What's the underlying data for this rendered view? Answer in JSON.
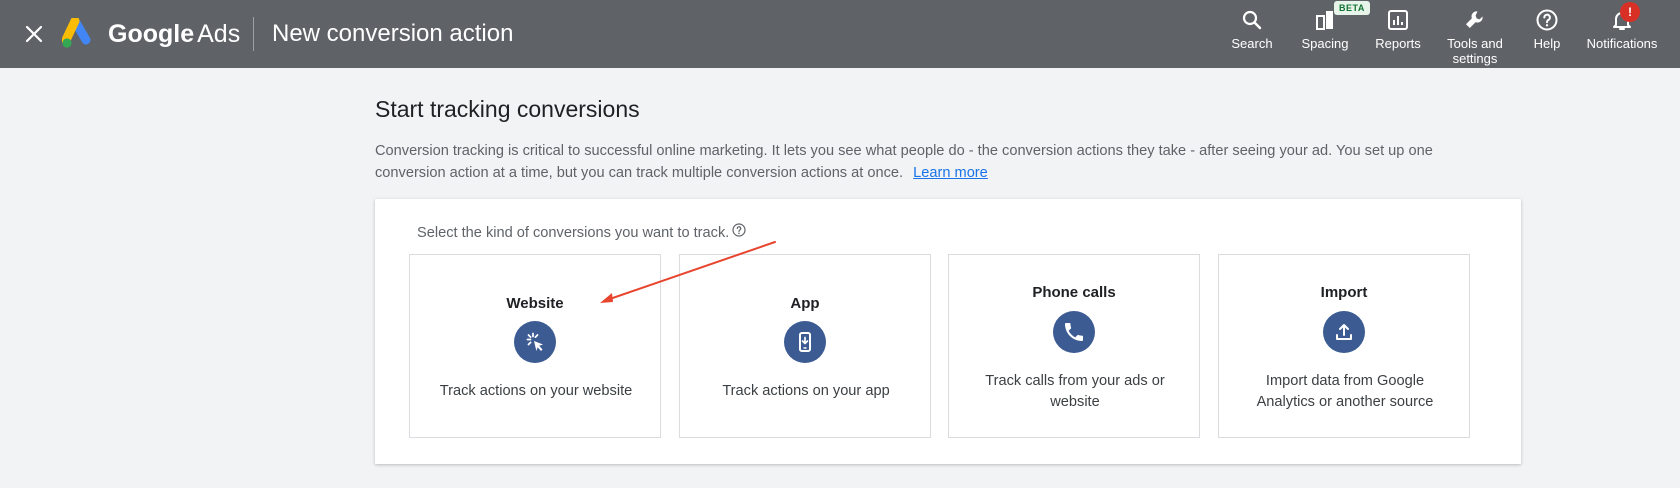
{
  "header": {
    "product_brand": "Google",
    "product_name": "Ads",
    "page_title": "New conversion action",
    "nav": {
      "search": "Search",
      "spacing": "Spacing",
      "spacing_badge": "BETA",
      "reports": "Reports",
      "tools_line1": "Tools and",
      "tools_line2": "settings",
      "help": "Help",
      "notifications": "Notifications",
      "notifications_badge": "!"
    }
  },
  "main": {
    "title": "Start tracking conversions",
    "intro": "Conversion tracking is critical to successful online marketing. It lets you see what people do - the conversion actions they take - after seeing your ad. You set up one conversion action at a time, but you can track multiple conversion actions at once.",
    "learn_more": "Learn more",
    "prompt": "Select the kind of conversions you want to track.",
    "options": [
      {
        "title": "Website",
        "desc": "Track actions on your website",
        "icon": "cursor-click-icon"
      },
      {
        "title": "App",
        "desc": "Track actions on your app",
        "icon": "phone-download-icon"
      },
      {
        "title": "Phone calls",
        "desc": "Track calls from your ads or website",
        "icon": "phone-icon"
      },
      {
        "title": "Import",
        "desc": "Import data from Google Analytics or another source",
        "icon": "upload-icon"
      }
    ]
  },
  "colors": {
    "topbar": "#5f6368",
    "icon_circle": "#3b5b92",
    "link": "#1a73e8",
    "annotation_arrow": "#e8452f",
    "notification_badge": "#d93025"
  }
}
